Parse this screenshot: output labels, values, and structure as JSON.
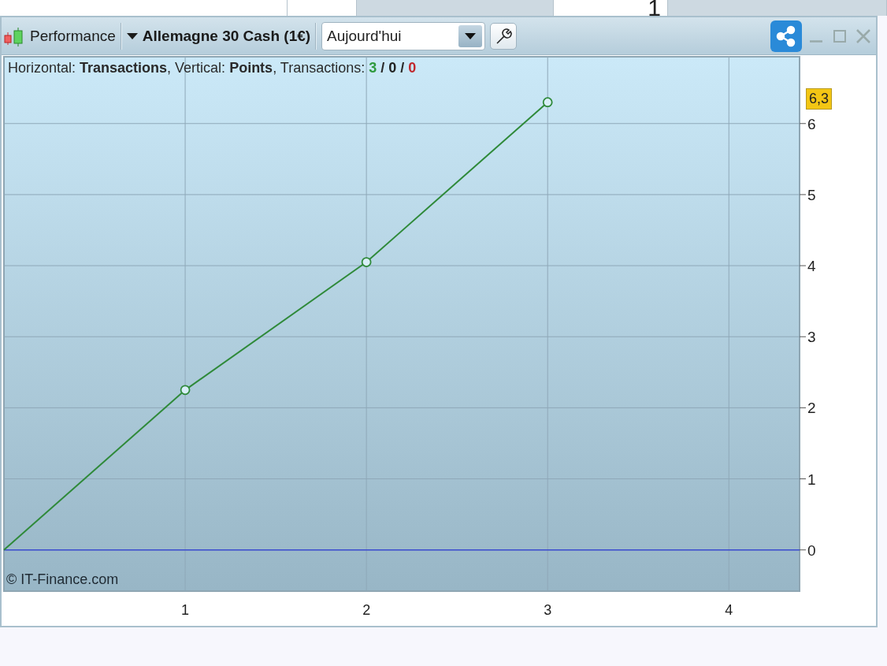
{
  "background_table": {
    "cells": [
      "",
      "",
      "",
      "1",
      ""
    ]
  },
  "toolbar": {
    "title": "Performance",
    "instrument": "Allemagne 30 Cash (1€)",
    "period": "Aujourd'hui"
  },
  "legend": {
    "text": "Horizontal: **Transactions**, Vertical: **Points**, Transactions:",
    "separator": "/",
    "counts": [
      {
        "value": "3",
        "color": "#2e9a3e"
      },
      {
        "value": "0",
        "color": "#222222"
      },
      {
        "value": "0",
        "color": "#c0282d"
      }
    ]
  },
  "value_badge": "6,3",
  "credit": "© IT-Finance.com",
  "chart_data": {
    "type": "line",
    "x": [
      0,
      1,
      2,
      3
    ],
    "series": [
      {
        "color": "#2f8a3a",
        "values": [
          0,
          2.25,
          4.05,
          6.3
        ]
      }
    ],
    "grid": true,
    "ref_lines": [
      {
        "axis": "y",
        "value": 0,
        "color": "#3a4bd0"
      }
    ],
    "xlim": [
      0,
      4.39
    ],
    "ylim": [
      -0.58,
      6.94
    ],
    "xticks": [
      1,
      2,
      3,
      4
    ],
    "yticks": [
      0,
      1,
      2,
      3,
      4,
      5,
      6
    ]
  }
}
